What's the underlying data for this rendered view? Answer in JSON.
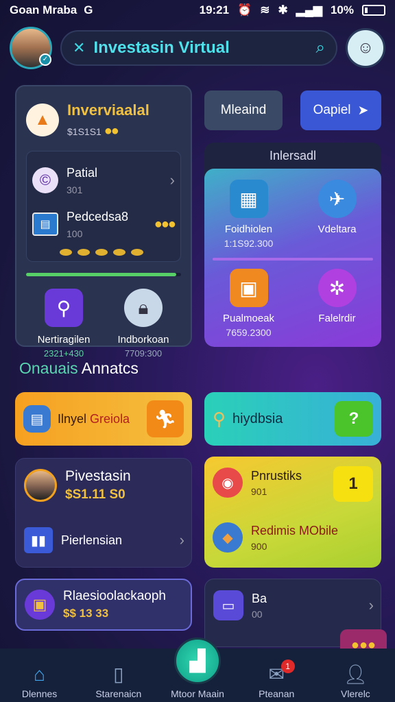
{
  "status": {
    "left_text": "Goan Mraba",
    "left_icon": "G",
    "time": "19:21",
    "battery": "10%"
  },
  "header": {
    "search_title": "Investasin Virtual",
    "close_icon": "✕",
    "search_icon": "⌕"
  },
  "panel_left": {
    "title": "Inverviaalal",
    "subtitle": "$1S1S1",
    "row1": {
      "label": "Patial",
      "value": "301"
    },
    "row2": {
      "label": "Pedcedsa8",
      "value": "100"
    },
    "progress_fraction": 0.97,
    "bottom": [
      {
        "label": "Nertiragilen",
        "value": "2321+430"
      },
      {
        "label": "Indborkoan",
        "value": "7709:300"
      }
    ]
  },
  "buttons": {
    "mid_a": "Mleaind",
    "mid_b": "Oapiel"
  },
  "panel_right": {
    "heading": "Inlersadl",
    "cells": [
      {
        "label": "Foidhiolen",
        "value": "1:1S92.300"
      },
      {
        "label": "Vdeltara",
        "value": ""
      },
      {
        "label": "Pualmoeak",
        "value": "7659.2300"
      },
      {
        "label": "Falelrdir",
        "value": ""
      }
    ]
  },
  "section": {
    "title_part1": "Onauais",
    "title_part2": "Annatcs"
  },
  "cards": {
    "orange": {
      "label_part1": "Ilnyel",
      "label_part2": "Greiola"
    },
    "teal": {
      "label": "hiydbsia",
      "badge": "?"
    },
    "purple_a": {
      "title": "Pivestasin",
      "value": "$S1.11 S0",
      "row_label": "Pierlensian"
    },
    "yellow": {
      "title": "Pnrustiks",
      "value": "901",
      "badge": "1",
      "row_title": "Redimis MObile",
      "row_value": "900"
    },
    "outline": {
      "title": "Rlaesioolackaoph",
      "value": "$$ 13 33"
    },
    "dark": {
      "title": "Ba",
      "value": "00"
    }
  },
  "nav": {
    "items": [
      {
        "label": "Dlennes",
        "icon": "home-icon"
      },
      {
        "label": "Starenaicn",
        "icon": "tablet-icon"
      },
      {
        "label": "Mtoor Maain",
        "icon": "chart-icon"
      },
      {
        "label": "Pteanan",
        "icon": "mail-icon",
        "badge": "1"
      },
      {
        "label": "Vlerelc",
        "icon": "user-icon"
      }
    ]
  }
}
